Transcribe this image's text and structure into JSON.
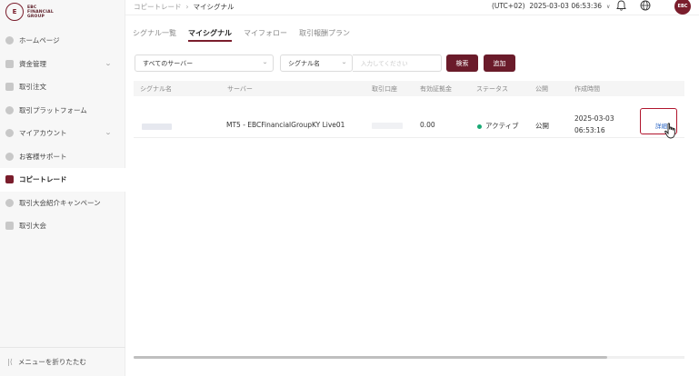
{
  "brand": {
    "line1": "EBC",
    "line2": "FINANCIAL",
    "line3": "GROUP"
  },
  "sidebar": {
    "items": [
      {
        "label": "ホームページ"
      },
      {
        "label": "資金管理"
      },
      {
        "label": "取引注文"
      },
      {
        "label": "取引プラットフォーム"
      },
      {
        "label": "マイアカウント"
      },
      {
        "label": "お客様サポート"
      },
      {
        "label": "コピートレード"
      },
      {
        "label": "取引大会紹介キャンペーン"
      },
      {
        "label": "取引大会"
      }
    ],
    "collapse_label": "メニューを折りたたむ"
  },
  "header": {
    "breadcrumb_parent": "コピートレード",
    "breadcrumb_current": "マイシグナル",
    "timezone": "(UTC+02)",
    "datetime": "2025-03-03 06:53:36",
    "avatar_text": "EBC"
  },
  "tabs": [
    {
      "label": "シグナル一覧"
    },
    {
      "label": "マイシグナル"
    },
    {
      "label": "マイフォロー"
    },
    {
      "label": "取引報酬プラン"
    }
  ],
  "filters": {
    "server_value": "すべてのサーバー",
    "field_value": "シグナル名",
    "input_placeholder": "入力してください",
    "search_label": "検索",
    "add_label": "追加"
  },
  "table": {
    "columns": [
      "シグナル名",
      "サーバー",
      "取引口座",
      "有効証拠金",
      "ステータス",
      "公開",
      "作成時間"
    ],
    "rows": [
      {
        "server": "MT5 - EBCFinancialGroupKY Live01",
        "equity": "0.00",
        "status": "アクティブ",
        "public": "公開",
        "created_date": "2025-03-03",
        "created_time": "06:53:16",
        "action": "詳細"
      }
    ]
  },
  "colors": {
    "accent": "#6a1b2a",
    "status_active": "#19a974",
    "link": "#2a64c4"
  }
}
